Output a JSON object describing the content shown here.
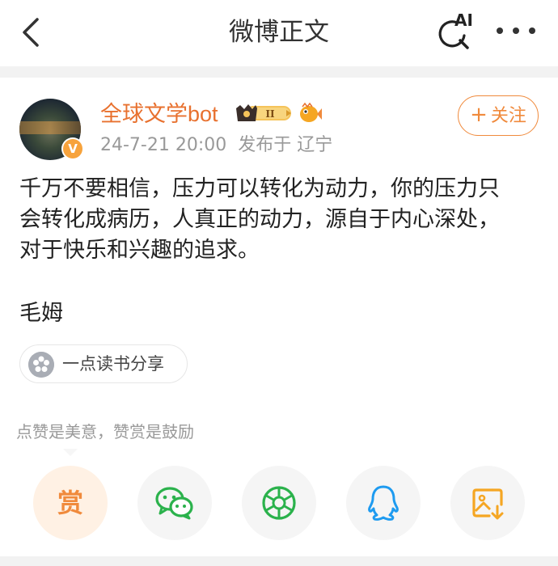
{
  "header": {
    "title": "微博正文",
    "ai_label": "AI"
  },
  "post": {
    "author": {
      "name": "全球文学bot",
      "badge_text": "II",
      "verified_mark": "V"
    },
    "meta": {
      "time": "24-7-21 20:00",
      "location": "发布于 辽宁"
    },
    "follow_label": "关注",
    "body_lines": [
      "千万不要相信，压力可以转化为动力，你的压力只",
      "会转化成病历，人真正的动力，源自于内心深处，",
      "对于快乐和兴趣的追求。"
    ],
    "signature": "毛姆",
    "share_chip_label": "一点读书分享"
  },
  "reward": {
    "tip": "点赞是美意，赞赏是鼓励",
    "reward_label": "赏"
  },
  "share_actions": [
    {
      "name": "wechat-icon",
      "color": "#2bb24c"
    },
    {
      "name": "wechat-moments-icon",
      "color": "#2bb24c"
    },
    {
      "name": "qq-icon",
      "color": "#1e9bf0"
    },
    {
      "name": "save-image-icon",
      "color": "#f5a623"
    }
  ],
  "colors": {
    "accent": "#f08a3c",
    "author_name": "#e8712f",
    "meta_text": "#999999"
  }
}
